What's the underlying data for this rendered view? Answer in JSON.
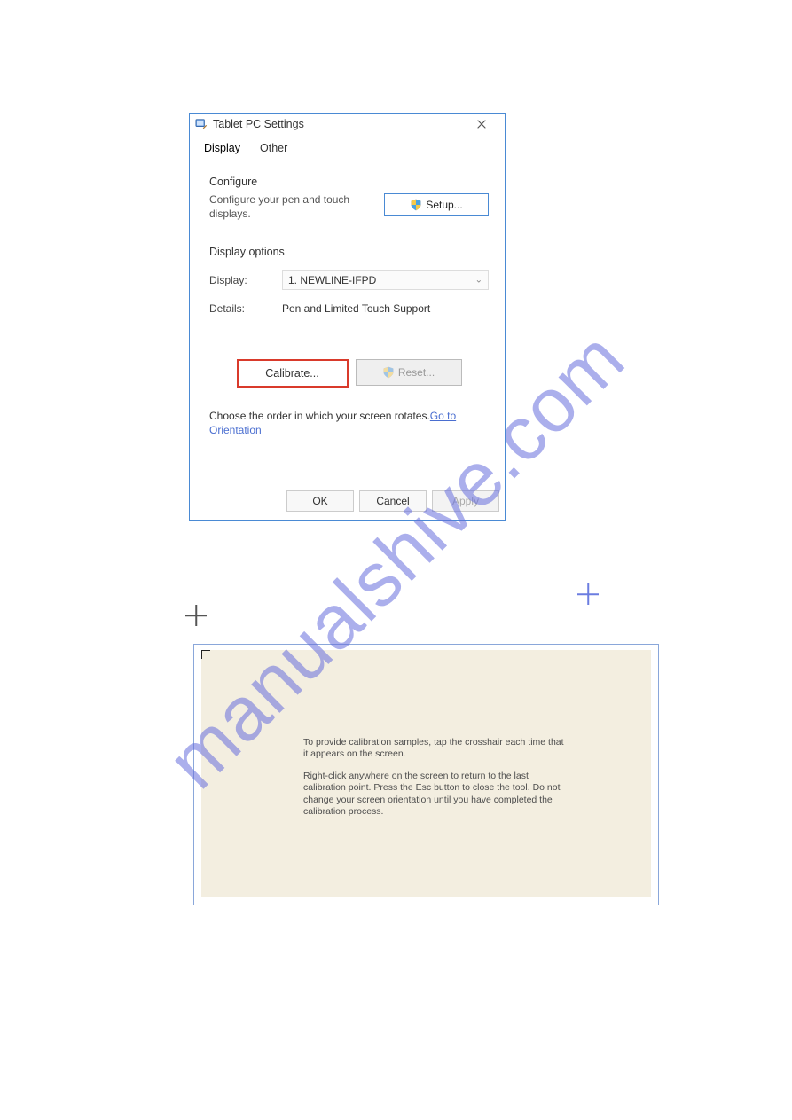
{
  "dialog": {
    "title": "Tablet PC Settings",
    "tabs": {
      "display": "Display",
      "other": "Other"
    },
    "configure": {
      "heading": "Configure",
      "desc": "Configure your pen and touch displays.",
      "setup_label": "Setup..."
    },
    "display_options": {
      "heading": "Display options",
      "display_label": "Display:",
      "display_value": "1. NEWLINE-IFPD",
      "details_label": "Details:",
      "details_value": "Pen and Limited Touch Support"
    },
    "buttons": {
      "calibrate": "Calibrate...",
      "reset": "Reset..."
    },
    "rotate_text": "Choose the order in which your screen rotates.",
    "rotate_link": "Go to Orientation",
    "footer": {
      "ok": "OK",
      "cancel": "Cancel",
      "apply": "Apply"
    }
  },
  "calibration_screen": {
    "p1": "To provide calibration samples, tap the crosshair each time that it appears on the screen.",
    "p2": "Right-click anywhere on the screen to return to the last calibration point. Press the Esc button to close the tool. Do not change your screen orientation until you have completed the calibration process."
  },
  "watermark": "manualshive.com"
}
